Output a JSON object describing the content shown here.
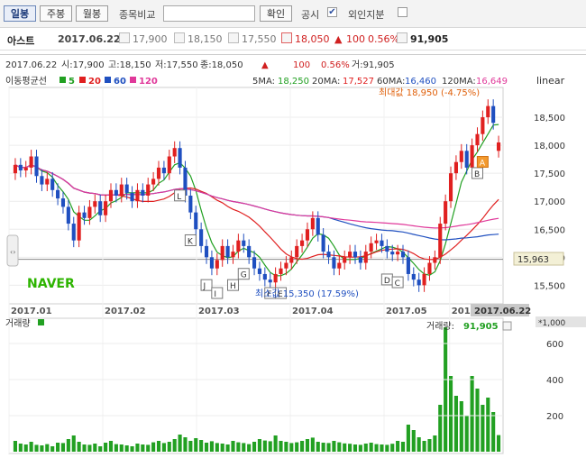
{
  "toolbar": {
    "tab_daily": "일봉",
    "tab_weekly": "주봉",
    "tab_monthly": "월봉",
    "compare_label": "종목비교",
    "confirm_label": "확인",
    "disclosure_label": "공시",
    "disclosure_checked": "✔",
    "foreign_label": "외인지분"
  },
  "info": {
    "name": "아스트",
    "date": "2017.06.22",
    "open": "17,900",
    "high": "18,150",
    "low": "17,550",
    "close": "18,050",
    "change_symbol": "▲",
    "change": "100",
    "change_pct": "0.56%",
    "volume": "91,905"
  },
  "chart": {
    "ohlc_header": {
      "date": "2017.06.22",
      "open": "시:17,900",
      "high": "고:18,150",
      "low": "저:17,550",
      "close": "종:18,050",
      "arrow": "▲",
      "change": "100",
      "pct": "0.56%",
      "vol": "거:91,905"
    },
    "ma_legend_title": "이동평균선",
    "ma_legend": [
      {
        "name": "5",
        "color": "#22a022"
      },
      {
        "name": "20",
        "color": "#e02020"
      },
      {
        "name": "60",
        "color": "#2050c0"
      },
      {
        "name": "120",
        "color": "#e0399a"
      }
    ],
    "ma_values": {
      "ma5_label": "5MA:",
      "ma5": "18,250",
      "ma20_label": "20MA:",
      "ma20": "17,527",
      "ma60_label": "60MA:",
      "ma60": "16,460",
      "ma120_label": "120MA:",
      "ma120": "16,649"
    },
    "scale_label": "linear",
    "max_label": "최대값 18,950 (-4.75%)",
    "min_label": "최소값 15,350 (17.59%)",
    "current_price_label": "15,963",
    "brand": "NAVER",
    "current_date_label": "2017.06.22",
    "volume_title": "거래량",
    "volume_label": "거래량:",
    "volume_value": "91,905",
    "volume_unit": "*1,000"
  },
  "chart_data": {
    "type": "candlestick",
    "x_tick_labels": [
      "2017.01",
      "2017.02",
      "2017.03",
      "2017.04",
      "2017.05",
      "2017.06"
    ],
    "y_tick_labels": [
      "15,500",
      "16,000",
      "16,500",
      "17,000",
      "17,500",
      "18,000",
      "18,500"
    ],
    "ylim": [
      15200,
      19000
    ],
    "volume_tick_labels": [
      "200",
      "400",
      "600"
    ],
    "volume_ylim": [
      0,
      700
    ],
    "volume_unit": "*1,000",
    "moving_averages": [
      "5",
      "20",
      "60",
      "120"
    ],
    "event_markers": [
      "L",
      "K",
      "J",
      "I",
      "H",
      "G",
      "F",
      "E",
      "D",
      "C",
      "B",
      "A"
    ],
    "close": [
      17650,
      17550,
      17600,
      17800,
      17450,
      17300,
      17400,
      17200,
      17050,
      16900,
      16600,
      16300,
      16800,
      16700,
      16900,
      17000,
      16750,
      17000,
      17200,
      17100,
      17300,
      17150,
      17000,
      17200,
      17100,
      17300,
      17400,
      17600,
      17500,
      17800,
      17950,
      17600,
      17100,
      16800,
      16500,
      16200,
      16000,
      15800,
      15950,
      16200,
      16000,
      16100,
      16300,
      16200,
      16000,
      15800,
      15700,
      15600,
      15550,
      15700,
      15800,
      15900,
      16000,
      16200,
      16300,
      16500,
      16700,
      16400,
      16100,
      16000,
      15800,
      15900,
      16000,
      16100,
      16000,
      15900,
      16100,
      16250,
      16300,
      16200,
      16100,
      16050,
      16100,
      16000,
      15700,
      15600,
      15500,
      15700,
      15900,
      16000,
      16600,
      17000,
      17500,
      17700,
      17900,
      17600,
      18000,
      18200,
      18500,
      18700,
      18400,
      18050
    ],
    "open": [
      17500,
      17650,
      17550,
      17600,
      17800,
      17450,
      17300,
      17400,
      17200,
      17050,
      16900,
      16600,
      16300,
      16800,
      16700,
      16900,
      17000,
      16750,
      17000,
      17200,
      17100,
      17300,
      17150,
      17000,
      17200,
      17100,
      17300,
      17400,
      17600,
      17500,
      17800,
      17950,
      17600,
      17100,
      16800,
      16500,
      16200,
      16000,
      15800,
      15950,
      16200,
      16000,
      16100,
      16300,
      16200,
      16000,
      15800,
      15700,
      15600,
      15550,
      15700,
      15800,
      15900,
      16000,
      16200,
      16300,
      16500,
      16700,
      16400,
      16100,
      16000,
      15800,
      15900,
      16000,
      16100,
      16000,
      15900,
      16100,
      16250,
      16300,
      16200,
      16100,
      16050,
      16100,
      16000,
      15700,
      15600,
      15500,
      15700,
      15900,
      16000,
      16600,
      17000,
      17500,
      17700,
      17900,
      17600,
      18000,
      18200,
      18500,
      18700,
      17900
    ],
    "volume": [
      60,
      45,
      40,
      55,
      38,
      35,
      42,
      30,
      50,
      48,
      70,
      90,
      55,
      40,
      38,
      45,
      30,
      50,
      60,
      42,
      40,
      35,
      30,
      45,
      40,
      38,
      52,
      60,
      48,
      55,
      70,
      95,
      80,
      60,
      75,
      65,
      50,
      58,
      48,
      45,
      40,
      60,
      52,
      48,
      42,
      55,
      70,
      62,
      58,
      90,
      60,
      55,
      48,
      52,
      60,
      70,
      78,
      55,
      50,
      48,
      60,
      52,
      46,
      44,
      40,
      38,
      45,
      50,
      42,
      40,
      38,
      44,
      60,
      55,
      150,
      120,
      80,
      60,
      70,
      90,
      260,
      690,
      420,
      310,
      280,
      200,
      420,
      350,
      260,
      300,
      220,
      92
    ]
  }
}
